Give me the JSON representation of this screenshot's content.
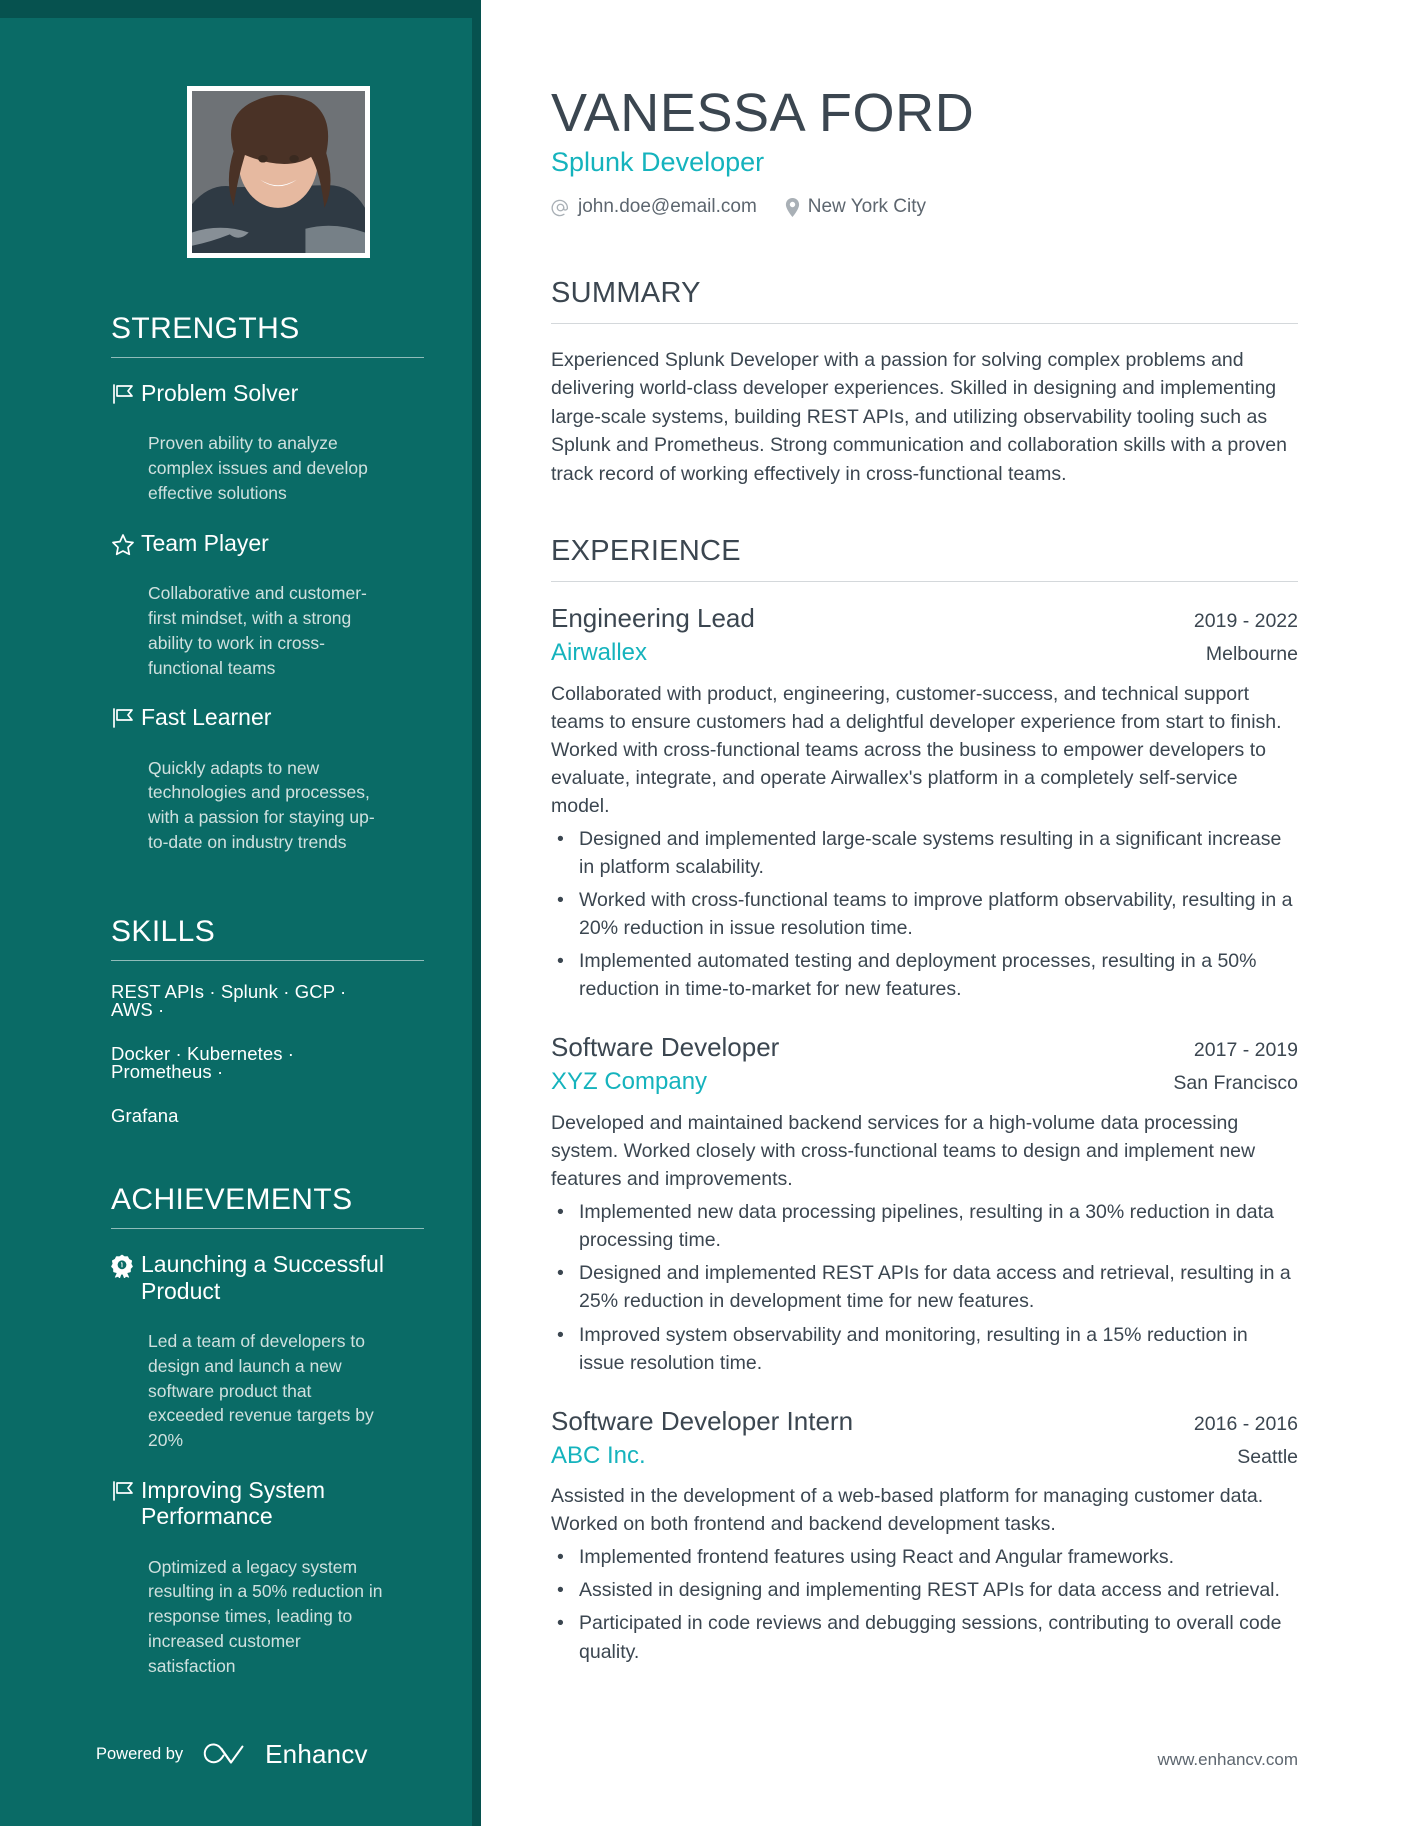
{
  "theme": {
    "sidebar_bg": "#0a6b66",
    "sidebar_edge": "#06524f",
    "accent": "#15b3bd",
    "text": "#3b4650",
    "muted": "#5d666f",
    "sidebar_desc": "#cfe0de"
  },
  "header": {
    "name": "VANESSA FORD",
    "role": "Splunk Developer",
    "email_icon": "at-icon",
    "email": "john.doe@email.com",
    "location_icon": "location-pin-icon",
    "location": "New York City"
  },
  "sidebar": {
    "photo_alt": "profile-photo",
    "strengths": {
      "heading": "STRENGTHS",
      "items": [
        {
          "icon": "flag-icon",
          "title": "Problem Solver",
          "desc": "Proven ability to analyze complex issues and develop effective solutions"
        },
        {
          "icon": "star-icon",
          "title": "Team Player",
          "desc": "Collaborative and customer-first mindset, with a strong ability to work in cross-functional teams"
        },
        {
          "icon": "flag-icon",
          "title": "Fast Learner",
          "desc": "Quickly adapts to new technologies and processes, with a passion for staying up-to-date on industry trends"
        }
      ]
    },
    "skills": {
      "heading": "SKILLS",
      "rows": [
        "REST APIs · Splunk · GCP · AWS ·",
        "Docker · Kubernetes · Prometheus ·",
        "Grafana"
      ]
    },
    "achievements": {
      "heading": "ACHIEVEMENTS",
      "items": [
        {
          "icon": "award-ribbon-icon",
          "title": "Launching a Successful Product",
          "desc": "Led a team of developers to design and launch a new software product that exceeded revenue targets by 20%"
        },
        {
          "icon": "flag-icon",
          "title": "Improving System Performance",
          "desc": "Optimized a legacy system resulting in a 50% reduction in response times, leading to increased customer satisfaction"
        }
      ]
    },
    "footer": {
      "powered_by": "Powered by",
      "brand_icon": "enhancv-infinity-logo",
      "brand": "Enhancv"
    }
  },
  "main": {
    "summary": {
      "heading": "SUMMARY",
      "text": "Experienced Splunk Developer with a passion for solving complex problems and delivering world-class developer experiences. Skilled in designing and implementing large-scale systems, building REST APIs, and utilizing observability tooling such as Splunk and Prometheus. Strong communication and collaboration skills with a proven track record of working effectively in cross-functional teams."
    },
    "experience": {
      "heading": "EXPERIENCE",
      "jobs": [
        {
          "title": "Engineering Lead",
          "dates": "2019 - 2022",
          "company": "Airwallex",
          "location": "Melbourne",
          "desc": "Collaborated with product, engineering, customer-success, and technical support teams to ensure customers had a delightful developer experience from start to finish. Worked with cross-functional teams across the business to empower developers to evaluate, integrate, and operate Airwallex's platform in a completely self-service model.",
          "bullets": [
            "Designed and implemented large-scale systems resulting in a significant increase in platform scalability.",
            "Worked with cross-functional teams to improve platform observability, resulting in a 20% reduction in issue resolution time.",
            "Implemented automated testing and deployment processes, resulting in a 50% reduction in time-to-market for new features."
          ]
        },
        {
          "title": "Software Developer",
          "dates": "2017 - 2019",
          "company": "XYZ Company",
          "location": "San Francisco",
          "desc": "Developed and maintained backend services for a high-volume data processing system. Worked closely with cross-functional teams to design and implement new features and improvements.",
          "bullets": [
            "Implemented new data processing pipelines, resulting in a 30% reduction in data processing time.",
            "Designed and implemented REST APIs for data access and retrieval, resulting in a 25% reduction in development time for new features.",
            "Improved system observability and monitoring, resulting in a 15% reduction in issue resolution time."
          ]
        },
        {
          "title": "Software Developer Intern",
          "dates": "2016 - 2016",
          "company": "ABC Inc.",
          "location": "Seattle",
          "desc": "Assisted in the development of a web-based platform for managing customer data. Worked on both frontend and backend development tasks.",
          "bullets": [
            "Implemented frontend features using React and Angular frameworks.",
            "Assisted in designing and implementing REST APIs for data access and retrieval.",
            "Participated in code reviews and debugging sessions, contributing to overall code quality."
          ]
        }
      ]
    },
    "footer": {
      "website": "www.enhancv.com"
    }
  }
}
